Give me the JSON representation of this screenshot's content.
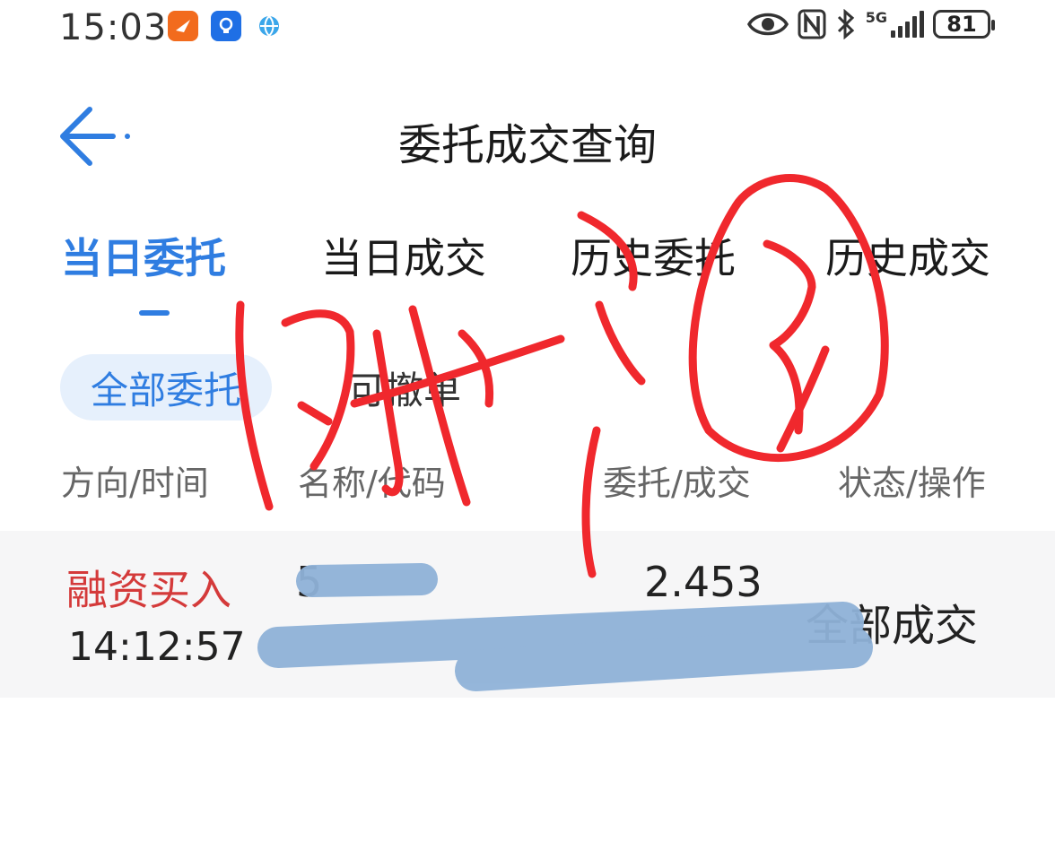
{
  "status_bar": {
    "time": "15:03",
    "battery": "81",
    "network": "5G",
    "icons": [
      "app-orange-icon",
      "app-bulb-icon",
      "app-globe-icon",
      "eye-icon",
      "nfc-icon",
      "bluetooth-icon",
      "signal-icon",
      "battery-icon"
    ]
  },
  "header": {
    "title": "委托成交查询",
    "back_icon": "arrow-left-icon"
  },
  "tabs": [
    {
      "label": "当日委托",
      "active": true
    },
    {
      "label": "当日成交",
      "active": false
    },
    {
      "label": "历史委托",
      "active": false
    },
    {
      "label": "历史成交",
      "active": false
    }
  ],
  "filters": [
    {
      "label": "全部委托",
      "active": true
    },
    {
      "label": "可撤单",
      "active": false
    }
  ],
  "columns": [
    "方向/时间",
    "名称/代码",
    "委托/成交",
    "状态/操作"
  ],
  "rows": [
    {
      "direction": "融资买入",
      "time": "14:12:57",
      "code_prefix": "5",
      "price": "2.453",
      "status": "全部成交"
    }
  ],
  "colors": {
    "accent": "#2f7de1",
    "buy": "#d43a3a",
    "scribble": "#f0282d",
    "redaction": "#8fb2d8"
  }
}
